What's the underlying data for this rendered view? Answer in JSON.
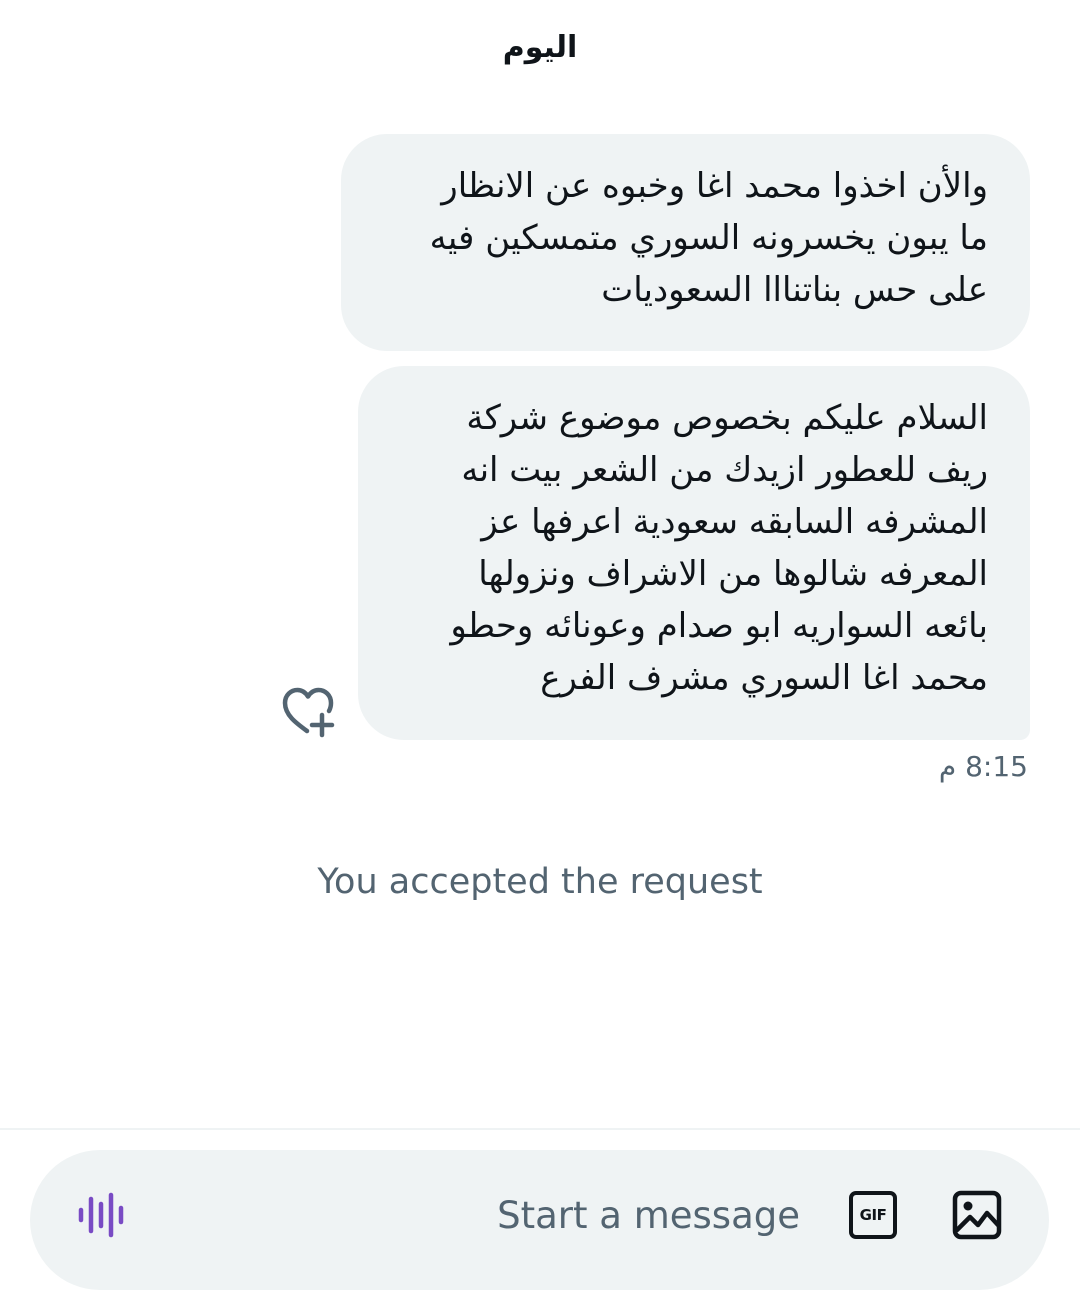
{
  "conversation": {
    "date_separator": "اليوم",
    "messages": [
      {
        "lines": [
          "والأن اخذوا محمد اغا وخبوه عن الانظار",
          "ما يبون يخسرونه السوري متمسكين فيه",
          "على حس بناتنااا السعوديات"
        ]
      },
      {
        "lines": [
          "السلام عليكم بخصوص موضوع شركة",
          "ريف للعطور ازيدك من الشعر بيت انه",
          "المشرفه السابقه سعودية اعرفها عز",
          "المعرفه شالوها من الاشراف ونزولها",
          "بائعه السواريه ابو صدام وعونائه وحطو",
          "محمد اغا السوري مشرف الفرع"
        ],
        "timestamp": "8:15 م"
      }
    ],
    "system_message": "You accepted the request"
  },
  "composer": {
    "placeholder": "Start a message",
    "gif_label": "GIF",
    "icons": {
      "voice": "audio-waveform-icon",
      "gif": "gif-icon",
      "media": "image-icon",
      "reaction": "heart-plus-icon"
    }
  },
  "colors": {
    "accent": "#794bc4",
    "bubble_bg": "#eff3f4",
    "muted_text": "#536471",
    "primary_text": "#0f1419"
  }
}
